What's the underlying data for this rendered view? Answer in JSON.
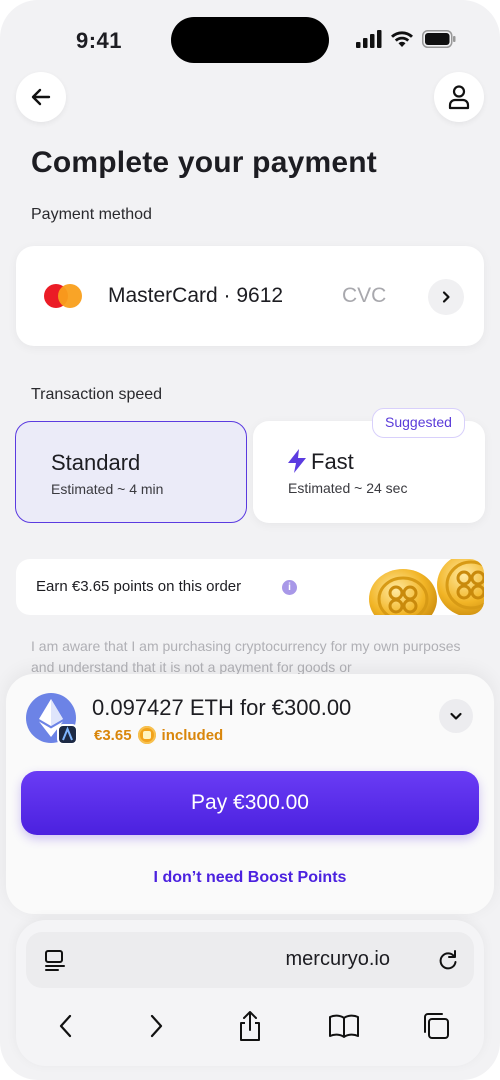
{
  "status_bar": {
    "time": "9:41"
  },
  "header": {
    "title": "Complete your payment"
  },
  "payment_method": {
    "label": "Payment method",
    "card_name": "MasterCard · 9612",
    "cvc_placeholder": "CVC"
  },
  "transaction_speed": {
    "label": "Transaction speed",
    "options": [
      {
        "name": "Standard",
        "estimate": "Estimated ~ 4 min",
        "selected": true
      },
      {
        "name": "Fast",
        "estimate": "Estimated ~ 24 sec",
        "badge": "Suggested"
      }
    ]
  },
  "earn_banner": {
    "text": "Earn €3.65 points on this order",
    "info": "i"
  },
  "disclaimer": "I am aware that I am purchasing cryptocurrency for my own purposes and understand that it is not a payment for goods or",
  "summary": {
    "amount_text": "0.097427 ETH for €300.00",
    "boost_value": "€3.65",
    "boost_suffix": "included",
    "pay_label": "Pay €300.00",
    "no_boost_label": "I don’t need Boost Points"
  },
  "browser": {
    "url": "mercuryo.io"
  },
  "colors": {
    "accent": "#5b3be0",
    "pay_button": "#4b21df",
    "boost_orange": "#d9860b",
    "background": "#f2f2f4"
  }
}
